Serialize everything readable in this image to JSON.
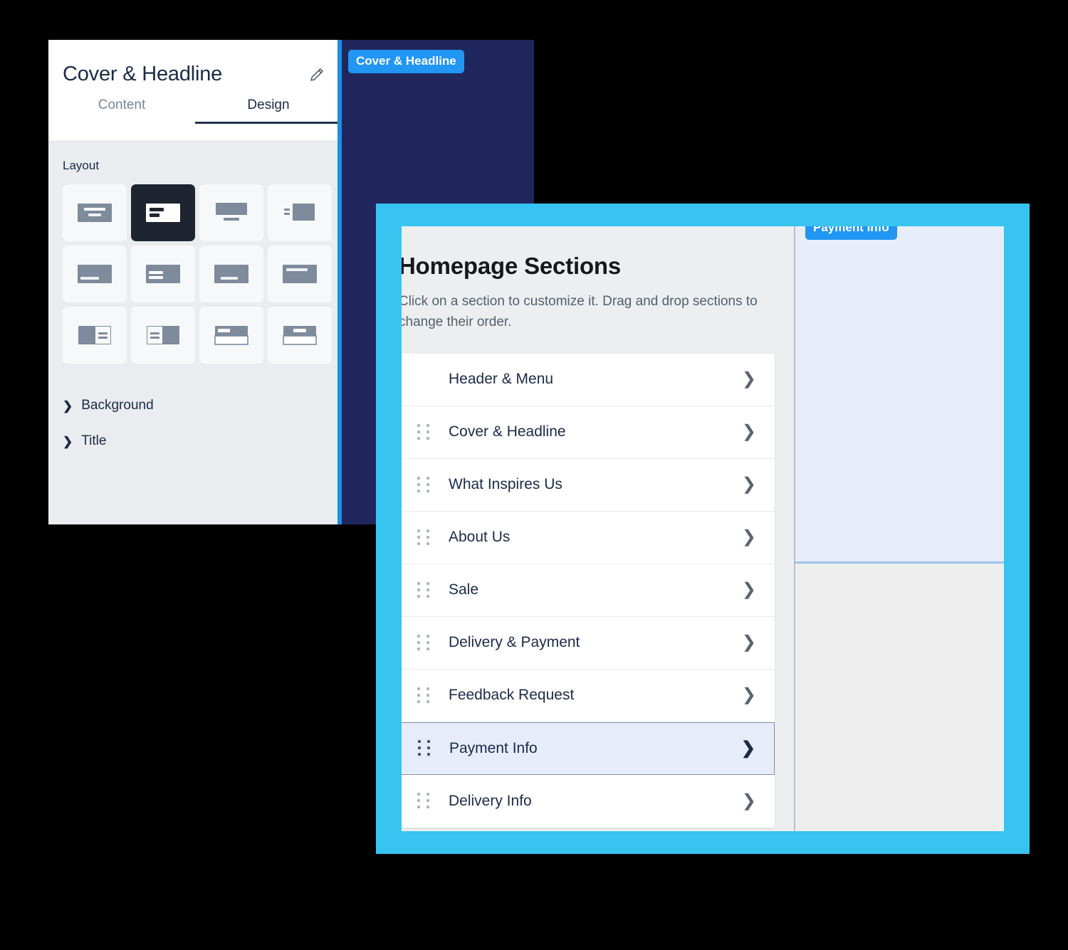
{
  "editor_panel": {
    "title": "Cover & Headline",
    "edit_icon": "pencil-icon",
    "tabs": [
      {
        "label": "Content",
        "active": false
      },
      {
        "label": "Design",
        "active": true
      }
    ],
    "layout_section_label": "Layout",
    "layout_options": [
      {
        "id": "centered-top-text",
        "selected": false
      },
      {
        "id": "left-aligned-text-box",
        "selected": true
      },
      {
        "id": "image-above-caption",
        "selected": false
      },
      {
        "id": "text-left-image-right-small",
        "selected": false
      },
      {
        "id": "image-with-bottom-left-bar",
        "selected": false
      },
      {
        "id": "image-with-left-two-bars",
        "selected": false
      },
      {
        "id": "image-with-bottom-center-bar",
        "selected": false
      },
      {
        "id": "image-with-top-bar",
        "selected": false
      },
      {
        "id": "image-left-text-right",
        "selected": false
      },
      {
        "id": "text-left-image-right",
        "selected": false
      },
      {
        "id": "banner-top-panel-bottom",
        "selected": false
      },
      {
        "id": "banner-centered-panel-bottom",
        "selected": false
      }
    ],
    "accordions": [
      {
        "label": "Background",
        "expanded": false,
        "icon": "chevron-right-icon"
      },
      {
        "label": "Title",
        "expanded": false,
        "icon": "chevron-right-icon"
      }
    ]
  },
  "navy_preview": {
    "badge": "Cover & Headline",
    "background_color": "#20275c",
    "badge_color": "#2196f3"
  },
  "sections_window": {
    "frame_color": "#38c4f0",
    "heading": "Homepage Sections",
    "description": "Click on a section to customize it. Drag and drop sections to change their order.",
    "sections": [
      {
        "label": "Header & Menu",
        "draggable": false,
        "selected": false,
        "chevron": "chevron-right-icon"
      },
      {
        "label": "Cover & Headline",
        "draggable": true,
        "selected": false,
        "chevron": "chevron-right-icon"
      },
      {
        "label": "What Inspires Us",
        "draggable": true,
        "selected": false,
        "chevron": "chevron-right-icon"
      },
      {
        "label": "About Us",
        "draggable": true,
        "selected": false,
        "chevron": "chevron-right-icon"
      },
      {
        "label": "Sale",
        "draggable": true,
        "selected": false,
        "chevron": "chevron-right-icon"
      },
      {
        "label": "Delivery & Payment",
        "draggable": true,
        "selected": false,
        "chevron": "chevron-right-icon"
      },
      {
        "label": "Feedback Request",
        "draggable": true,
        "selected": false,
        "chevron": "chevron-right-icon"
      },
      {
        "label": "Payment Info",
        "draggable": true,
        "selected": true,
        "chevron": "chevron-right-icon"
      },
      {
        "label": "Delivery Info",
        "draggable": true,
        "selected": false,
        "chevron": "chevron-right-icon"
      }
    ],
    "preview": {
      "badge": "Payment Info",
      "highlight_color": "#e7eef9",
      "badge_color": "#2196f3"
    }
  }
}
